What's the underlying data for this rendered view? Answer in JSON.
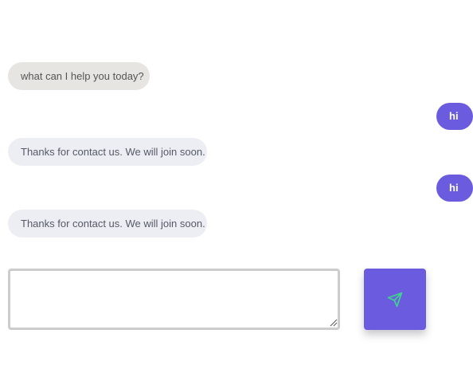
{
  "chat": {
    "messages": [
      {
        "sender": "bot",
        "text": "what can I help you today?"
      },
      {
        "sender": "user",
        "text": "hi"
      },
      {
        "sender": "bot",
        "text": "Thanks for contact us. We will join soon."
      },
      {
        "sender": "user",
        "text": "hi"
      },
      {
        "sender": "bot",
        "text": "Thanks for contact us. We will join soon."
      }
    ]
  },
  "composer": {
    "value": "",
    "placeholder": ""
  },
  "send_button": {
    "icon": "send-icon"
  },
  "colors": {
    "user_bubble": "#6b5cdf",
    "bot_greeting_bubble": "#e7e5e2",
    "bot_reply_bubble": "#eceef3",
    "send_icon": "#3dd68c"
  }
}
